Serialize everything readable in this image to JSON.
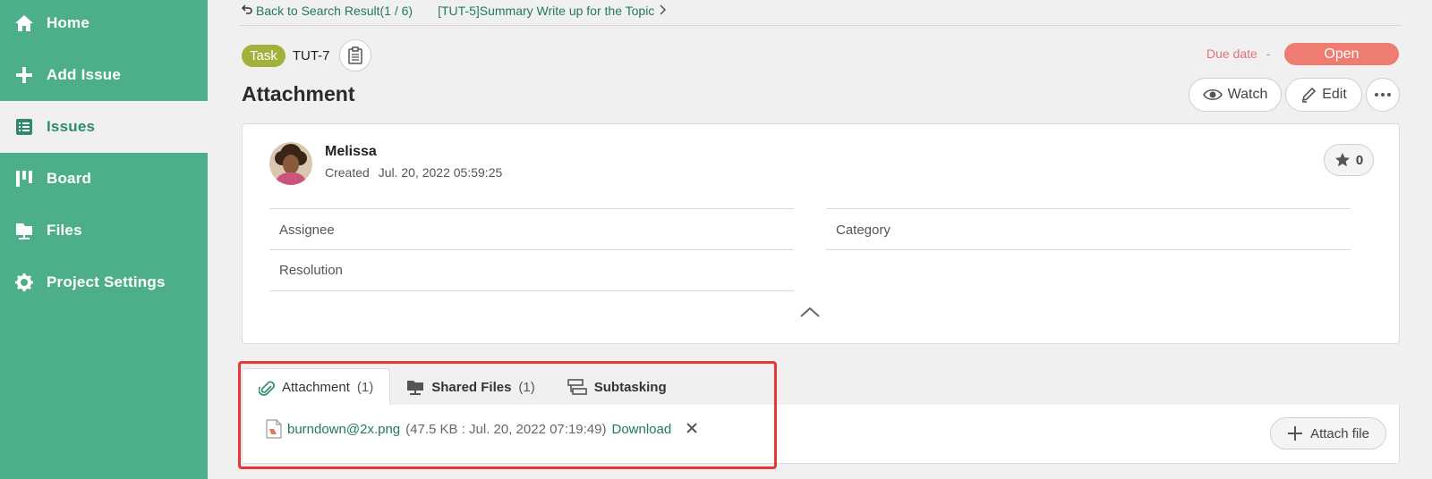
{
  "sidebar": {
    "items": [
      {
        "label": "Home",
        "icon": "home-icon"
      },
      {
        "label": "Add Issue",
        "icon": "plus-icon"
      },
      {
        "label": "Issues",
        "icon": "list-icon",
        "active": true
      },
      {
        "label": "Board",
        "icon": "board-icon"
      },
      {
        "label": "Files",
        "icon": "folder-icon"
      },
      {
        "label": "Project Settings",
        "icon": "gear-icon"
      }
    ]
  },
  "breadcrumb": {
    "back_label": "Back to Search Result(1 / 6)",
    "parent_label": "[TUT-5]Summary Write up for the Topic"
  },
  "issue": {
    "type": "Task",
    "key": "TUT-7",
    "title": "Attachment",
    "due_label": "Due date",
    "due_value": "-",
    "status": "Open"
  },
  "actions": {
    "watch_label": "Watch",
    "edit_label": "Edit"
  },
  "card": {
    "author": "Melissa",
    "created_label": "Created",
    "created_value": "Jul. 20, 2022 05:59:25",
    "star_count": "0",
    "fields": {
      "assignee": "Assignee",
      "category": "Category",
      "resolution": "Resolution"
    }
  },
  "tabs": [
    {
      "name": "Attachment",
      "count": "(1)",
      "active": true
    },
    {
      "name": "Shared Files",
      "count": "(1)"
    },
    {
      "name": "Subtasking",
      "count": ""
    }
  ],
  "attachment": {
    "file_name": "burndown@2x.png",
    "file_meta": "(47.5 KB : Jul. 20, 2022 07:19:49)",
    "download_label": "Download",
    "attach_button_label": "Attach file"
  },
  "colors": {
    "sidebar": "#4caf8a",
    "accent_link": "#217a5c",
    "task_badge": "#a1b13b",
    "status_open": "#ef7c71",
    "highlight": "#e53935"
  }
}
